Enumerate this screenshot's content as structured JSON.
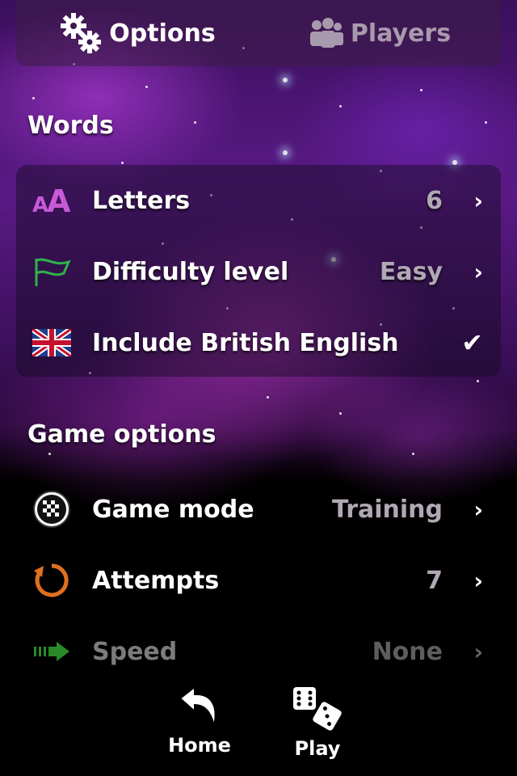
{
  "tabs": {
    "options": {
      "label": "Options",
      "icon": "gear-icon"
    },
    "players": {
      "label": "Players",
      "icon": "people-icon"
    }
  },
  "sections": {
    "words": {
      "title": "Words",
      "rows": [
        {
          "label": "Letters",
          "value": "6",
          "icon": "letters-icon"
        },
        {
          "label": "Difficulty level",
          "value": "Easy",
          "icon": "flag-icon"
        },
        {
          "label": "Include British English",
          "value": "",
          "icon": "uk-flag-icon",
          "checked": true
        }
      ]
    },
    "game_options": {
      "title": "Game options",
      "rows": [
        {
          "label": "Game mode",
          "value": "Training",
          "icon": "checkered-flag-icon"
        },
        {
          "label": "Attempts",
          "value": "7",
          "icon": "refresh-icon"
        },
        {
          "label": "Speed",
          "value": "None",
          "icon": "speed-arrow-icon",
          "disabled": true
        }
      ]
    }
  },
  "bottom": {
    "home_label": "Home",
    "play_label": "Play"
  },
  "glyphs": {
    "chevron": "›",
    "check": "✔"
  }
}
